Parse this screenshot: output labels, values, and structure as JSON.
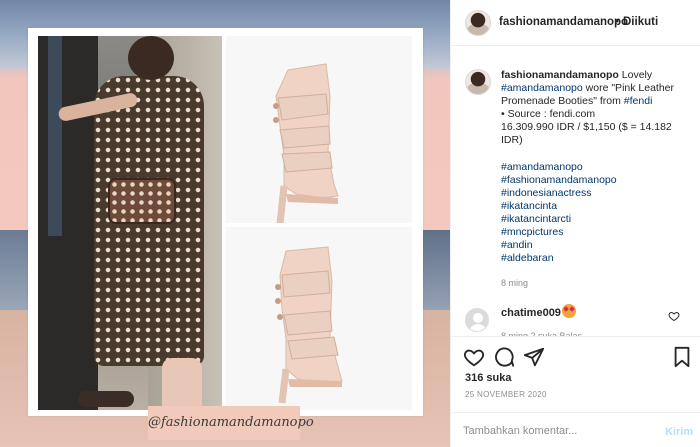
{
  "post": {
    "username": "fashionamandamanopo",
    "follow_separator": "•",
    "follow_status": "Diikuti",
    "watermark": "@fashionamandamanopo"
  },
  "caption": {
    "username": "fashionamandamanopo",
    "text_1": "Lovely",
    "mention": "#amandamanopo",
    "text_2": "wore \"Pink Leather Promenade Booties\" from",
    "brand_tag": "#fendi",
    "source": "• Source : fendi.com",
    "price": "16.309.990 IDR / $1,150 ($ = 14.182 IDR)",
    "hashtags": [
      "#amandamanopo",
      "#fashionamandamanopo",
      "#indonesianactress",
      "#ikatancinta",
      "#ikatancintarcti",
      "#mncpictures",
      "#andin",
      "#aldebaran"
    ],
    "time_ago": "8 ming"
  },
  "comment": {
    "username": "chatime009",
    "emoji": "heart-eyes-emoji",
    "meta": "8 ming    2 suka    Balas"
  },
  "actions": {
    "icons": [
      "heart-icon",
      "comment-icon",
      "share-icon",
      "save-icon"
    ]
  },
  "likes": "316 suka",
  "date": "25 NOVEMBER 2020",
  "comment_box": {
    "placeholder": "Tambahkan komentar...",
    "send_label": "Kirim"
  },
  "colors": {
    "link": "#00376b",
    "send_disabled": "#b2dffc",
    "muted": "#8e8e8e"
  }
}
